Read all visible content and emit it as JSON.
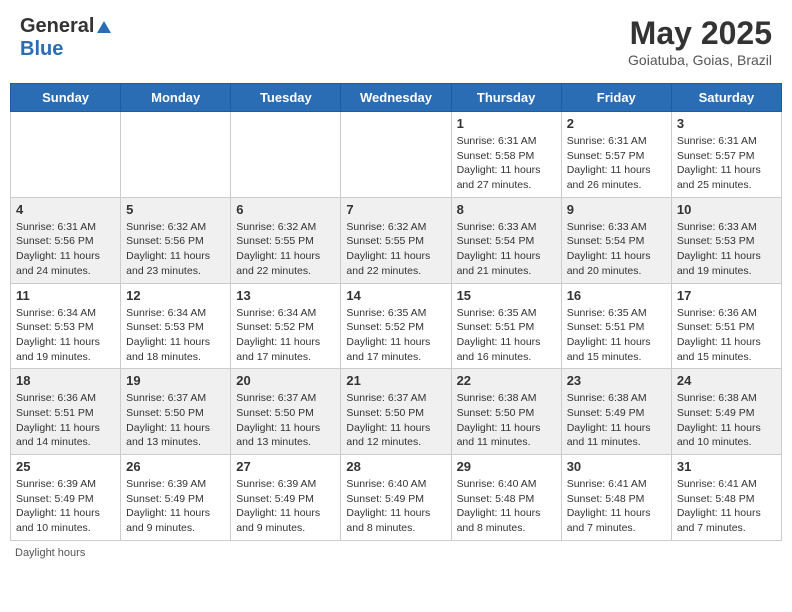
{
  "header": {
    "logo_general": "General",
    "logo_blue": "Blue",
    "month_title": "May 2025",
    "subtitle": "Goiatuba, Goias, Brazil"
  },
  "days_of_week": [
    "Sunday",
    "Monday",
    "Tuesday",
    "Wednesday",
    "Thursday",
    "Friday",
    "Saturday"
  ],
  "weeks": [
    [
      {
        "day": "",
        "sunrise": "",
        "sunset": "",
        "daylight": ""
      },
      {
        "day": "",
        "sunrise": "",
        "sunset": "",
        "daylight": ""
      },
      {
        "day": "",
        "sunrise": "",
        "sunset": "",
        "daylight": ""
      },
      {
        "day": "",
        "sunrise": "",
        "sunset": "",
        "daylight": ""
      },
      {
        "day": "1",
        "sunrise": "Sunrise: 6:31 AM",
        "sunset": "Sunset: 5:58 PM",
        "daylight": "Daylight: 11 hours and 27 minutes."
      },
      {
        "day": "2",
        "sunrise": "Sunrise: 6:31 AM",
        "sunset": "Sunset: 5:57 PM",
        "daylight": "Daylight: 11 hours and 26 minutes."
      },
      {
        "day": "3",
        "sunrise": "Sunrise: 6:31 AM",
        "sunset": "Sunset: 5:57 PM",
        "daylight": "Daylight: 11 hours and 25 minutes."
      }
    ],
    [
      {
        "day": "4",
        "sunrise": "Sunrise: 6:31 AM",
        "sunset": "Sunset: 5:56 PM",
        "daylight": "Daylight: 11 hours and 24 minutes."
      },
      {
        "day": "5",
        "sunrise": "Sunrise: 6:32 AM",
        "sunset": "Sunset: 5:56 PM",
        "daylight": "Daylight: 11 hours and 23 minutes."
      },
      {
        "day": "6",
        "sunrise": "Sunrise: 6:32 AM",
        "sunset": "Sunset: 5:55 PM",
        "daylight": "Daylight: 11 hours and 22 minutes."
      },
      {
        "day": "7",
        "sunrise": "Sunrise: 6:32 AM",
        "sunset": "Sunset: 5:55 PM",
        "daylight": "Daylight: 11 hours and 22 minutes."
      },
      {
        "day": "8",
        "sunrise": "Sunrise: 6:33 AM",
        "sunset": "Sunset: 5:54 PM",
        "daylight": "Daylight: 11 hours and 21 minutes."
      },
      {
        "day": "9",
        "sunrise": "Sunrise: 6:33 AM",
        "sunset": "Sunset: 5:54 PM",
        "daylight": "Daylight: 11 hours and 20 minutes."
      },
      {
        "day": "10",
        "sunrise": "Sunrise: 6:33 AM",
        "sunset": "Sunset: 5:53 PM",
        "daylight": "Daylight: 11 hours and 19 minutes."
      }
    ],
    [
      {
        "day": "11",
        "sunrise": "Sunrise: 6:34 AM",
        "sunset": "Sunset: 5:53 PM",
        "daylight": "Daylight: 11 hours and 19 minutes."
      },
      {
        "day": "12",
        "sunrise": "Sunrise: 6:34 AM",
        "sunset": "Sunset: 5:53 PM",
        "daylight": "Daylight: 11 hours and 18 minutes."
      },
      {
        "day": "13",
        "sunrise": "Sunrise: 6:34 AM",
        "sunset": "Sunset: 5:52 PM",
        "daylight": "Daylight: 11 hours and 17 minutes."
      },
      {
        "day": "14",
        "sunrise": "Sunrise: 6:35 AM",
        "sunset": "Sunset: 5:52 PM",
        "daylight": "Daylight: 11 hours and 17 minutes."
      },
      {
        "day": "15",
        "sunrise": "Sunrise: 6:35 AM",
        "sunset": "Sunset: 5:51 PM",
        "daylight": "Daylight: 11 hours and 16 minutes."
      },
      {
        "day": "16",
        "sunrise": "Sunrise: 6:35 AM",
        "sunset": "Sunset: 5:51 PM",
        "daylight": "Daylight: 11 hours and 15 minutes."
      },
      {
        "day": "17",
        "sunrise": "Sunrise: 6:36 AM",
        "sunset": "Sunset: 5:51 PM",
        "daylight": "Daylight: 11 hours and 15 minutes."
      }
    ],
    [
      {
        "day": "18",
        "sunrise": "Sunrise: 6:36 AM",
        "sunset": "Sunset: 5:51 PM",
        "daylight": "Daylight: 11 hours and 14 minutes."
      },
      {
        "day": "19",
        "sunrise": "Sunrise: 6:37 AM",
        "sunset": "Sunset: 5:50 PM",
        "daylight": "Daylight: 11 hours and 13 minutes."
      },
      {
        "day": "20",
        "sunrise": "Sunrise: 6:37 AM",
        "sunset": "Sunset: 5:50 PM",
        "daylight": "Daylight: 11 hours and 13 minutes."
      },
      {
        "day": "21",
        "sunrise": "Sunrise: 6:37 AM",
        "sunset": "Sunset: 5:50 PM",
        "daylight": "Daylight: 11 hours and 12 minutes."
      },
      {
        "day": "22",
        "sunrise": "Sunrise: 6:38 AM",
        "sunset": "Sunset: 5:50 PM",
        "daylight": "Daylight: 11 hours and 11 minutes."
      },
      {
        "day": "23",
        "sunrise": "Sunrise: 6:38 AM",
        "sunset": "Sunset: 5:49 PM",
        "daylight": "Daylight: 11 hours and 11 minutes."
      },
      {
        "day": "24",
        "sunrise": "Sunrise: 6:38 AM",
        "sunset": "Sunset: 5:49 PM",
        "daylight": "Daylight: 11 hours and 10 minutes."
      }
    ],
    [
      {
        "day": "25",
        "sunrise": "Sunrise: 6:39 AM",
        "sunset": "Sunset: 5:49 PM",
        "daylight": "Daylight: 11 hours and 10 minutes."
      },
      {
        "day": "26",
        "sunrise": "Sunrise: 6:39 AM",
        "sunset": "Sunset: 5:49 PM",
        "daylight": "Daylight: 11 hours and 9 minutes."
      },
      {
        "day": "27",
        "sunrise": "Sunrise: 6:39 AM",
        "sunset": "Sunset: 5:49 PM",
        "daylight": "Daylight: 11 hours and 9 minutes."
      },
      {
        "day": "28",
        "sunrise": "Sunrise: 6:40 AM",
        "sunset": "Sunset: 5:49 PM",
        "daylight": "Daylight: 11 hours and 8 minutes."
      },
      {
        "day": "29",
        "sunrise": "Sunrise: 6:40 AM",
        "sunset": "Sunset: 5:48 PM",
        "daylight": "Daylight: 11 hours and 8 minutes."
      },
      {
        "day": "30",
        "sunrise": "Sunrise: 6:41 AM",
        "sunset": "Sunset: 5:48 PM",
        "daylight": "Daylight: 11 hours and 7 minutes."
      },
      {
        "day": "31",
        "sunrise": "Sunrise: 6:41 AM",
        "sunset": "Sunset: 5:48 PM",
        "daylight": "Daylight: 11 hours and 7 minutes."
      }
    ]
  ],
  "footer": {
    "daylight_label": "Daylight hours"
  }
}
